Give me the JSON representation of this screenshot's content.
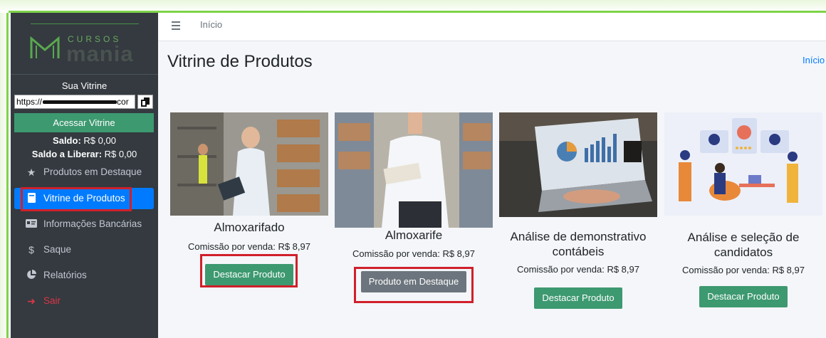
{
  "sidebar": {
    "logo_small": "CURSOS",
    "logo_big": "mania",
    "vitrine_title": "Sua Vitrine",
    "url_prefix": "https://",
    "url_suffix": "cor",
    "access_button": "Acessar Vitrine",
    "saldo_label": "Saldo:",
    "saldo_value": "R$ 0,00",
    "saldo_liberar_label": "Saldo a Liberar:",
    "saldo_liberar_value": "R$ 0,00",
    "nav": [
      {
        "label": "Produtos em Destaque",
        "icon": "star-icon"
      },
      {
        "label": "Vitrine de Produtos",
        "icon": "book-icon",
        "active": true
      },
      {
        "label": "Informações Bancárias",
        "icon": "id-card-icon"
      },
      {
        "label": "Saque",
        "icon": "hand-money-icon"
      },
      {
        "label": "Relatórios",
        "icon": "pie-chart-icon"
      },
      {
        "label": "Sair",
        "icon": "sign-out-icon"
      }
    ]
  },
  "topbar": {
    "home": "Início"
  },
  "main": {
    "title": "Vitrine de Produtos",
    "breadcrumb": "Início",
    "products": [
      {
        "name": "Almoxarifado",
        "commission": "Comissão por venda: R$ 8,97",
        "button": "Destacar Produto"
      },
      {
        "name": "Almoxarife",
        "commission": "Comissão por venda: R$ 8,97",
        "button": "Produto em Destaque"
      },
      {
        "name": "Análise de demonstrativo contábeis",
        "commission": "Comissão por venda: R$ 8,97",
        "button": "Destacar Produto"
      },
      {
        "name": "Análise e seleção de candidatos",
        "commission": "Comissão por venda: R$ 8,97",
        "button": "Destacar Produto"
      }
    ]
  },
  "colors": {
    "sidebar": "#343a40",
    "accent_green": "#3d9970",
    "active_blue": "#007bff",
    "highlight_red": "#d0202b"
  }
}
